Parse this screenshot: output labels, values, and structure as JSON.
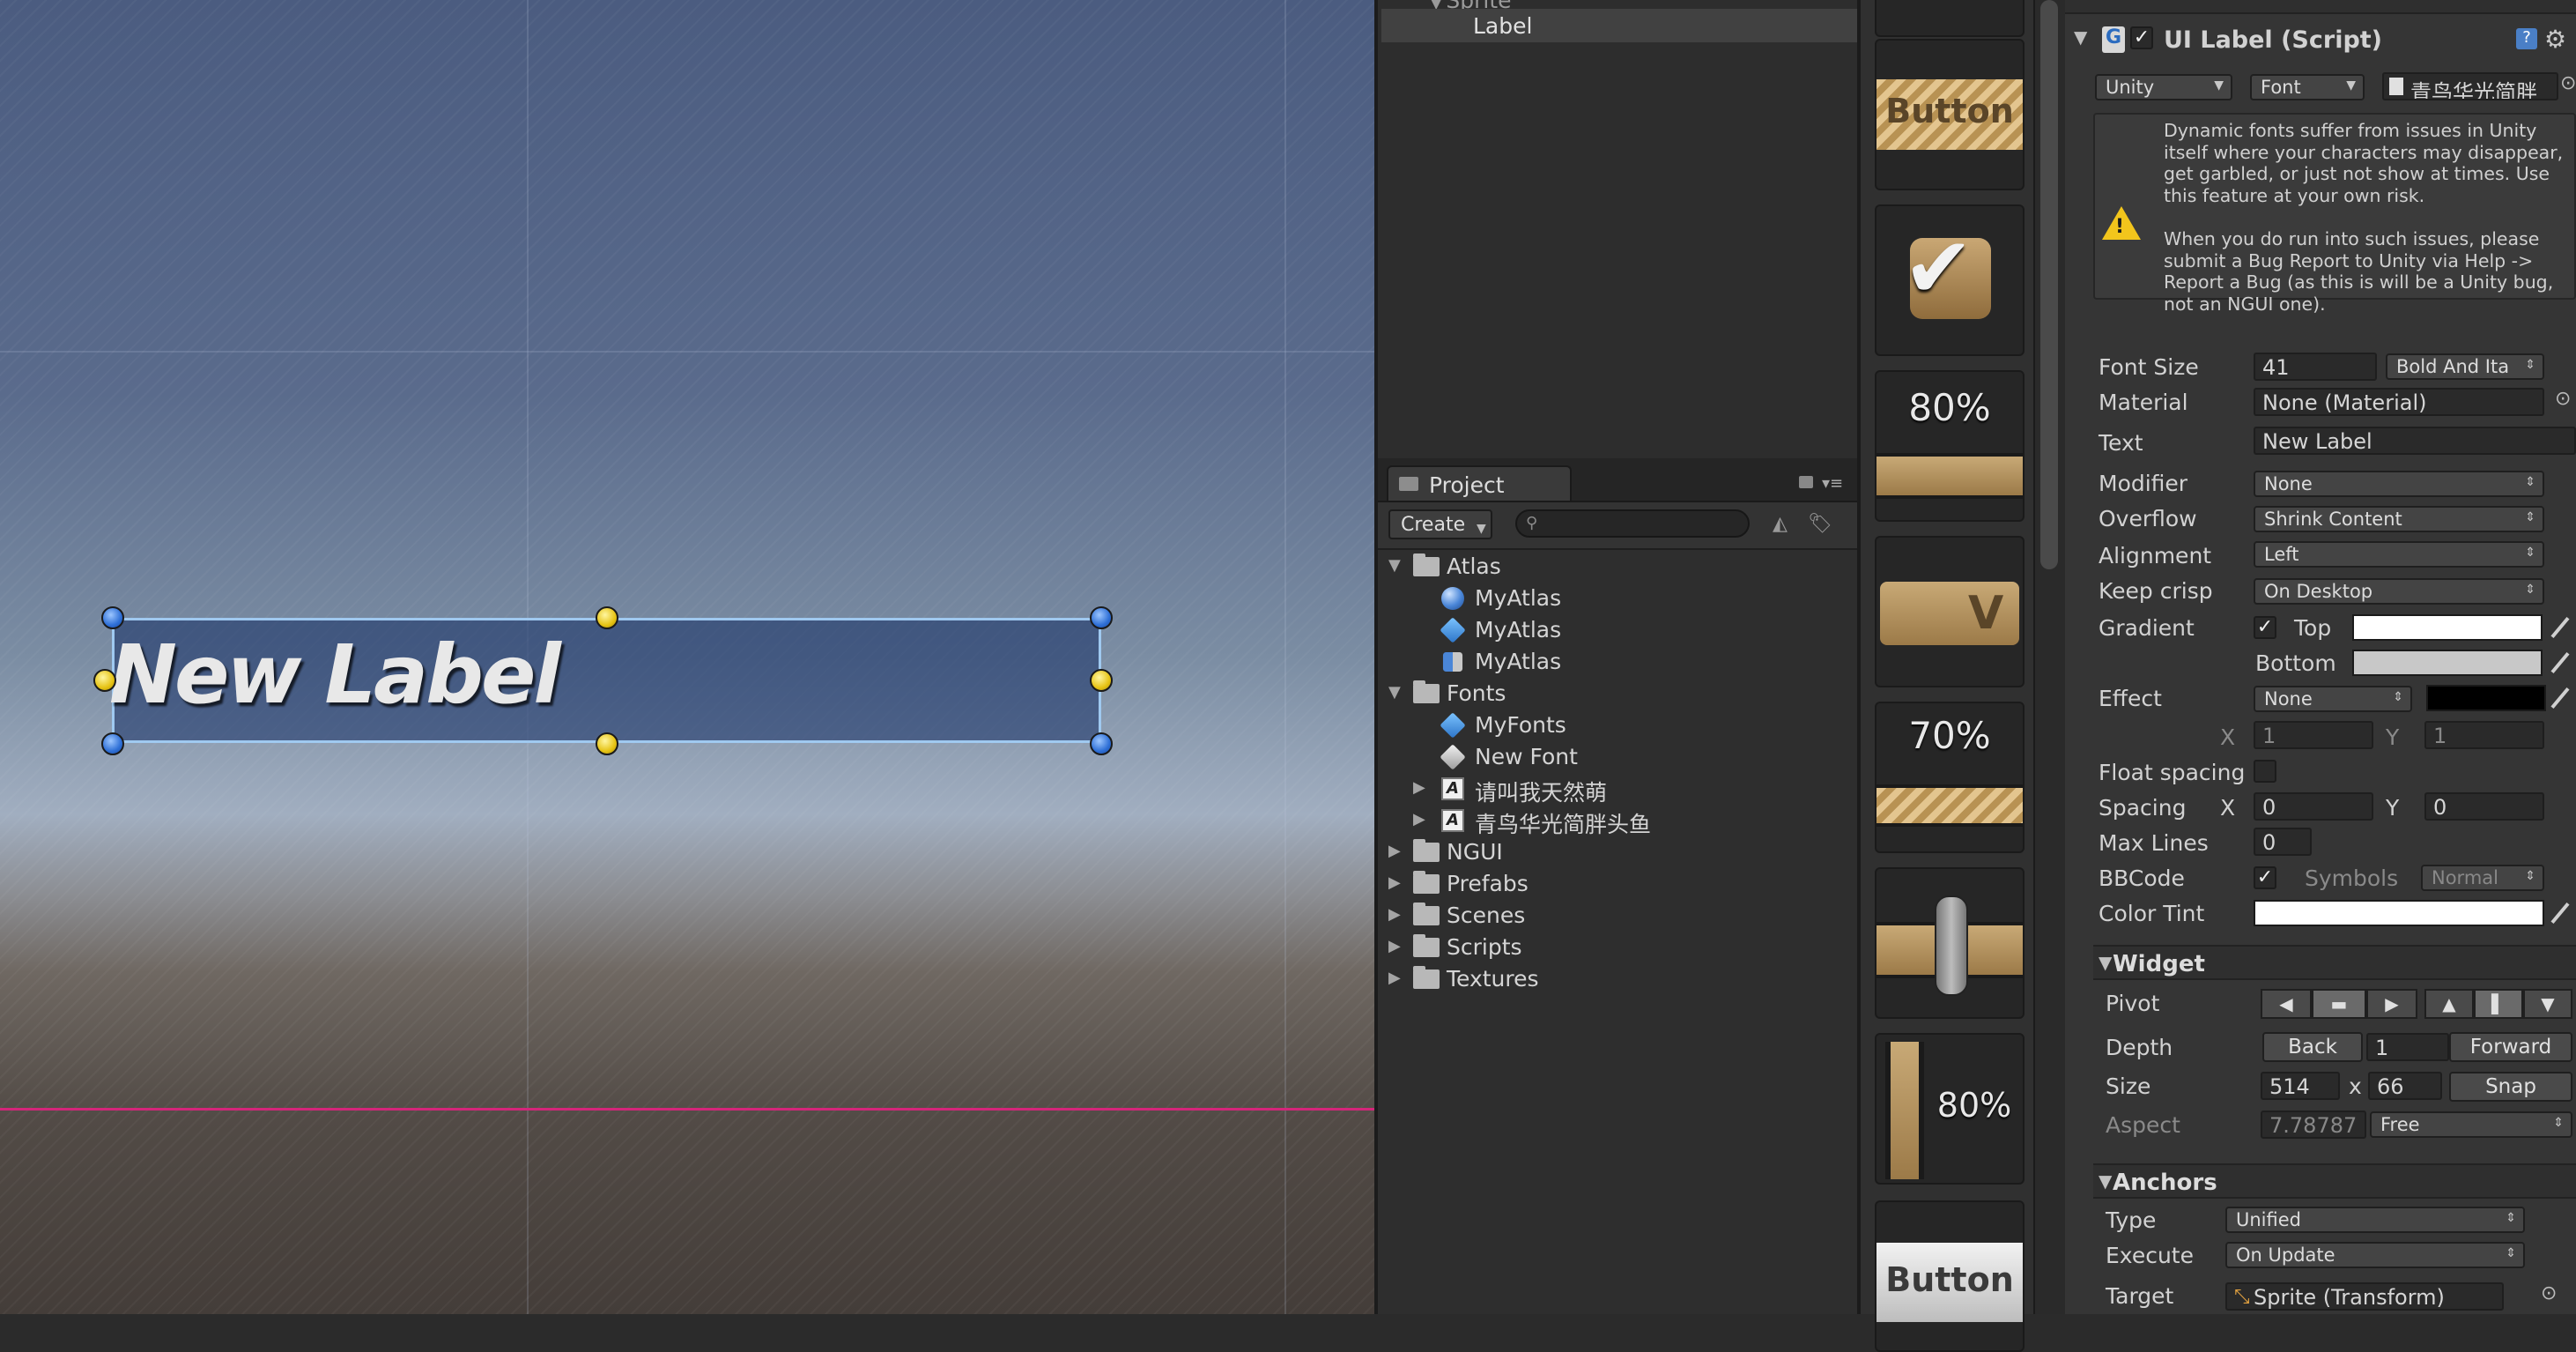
{
  "scene": {
    "label_text": "New Label"
  },
  "hierarchy": {
    "partial_row": "Sprite",
    "selected_row": "Label"
  },
  "project": {
    "tab_label": "Project",
    "create_label": "Create",
    "search_placeholder": "",
    "tree": [
      {
        "label": "Atlas",
        "kind": "folder",
        "expanded": true,
        "indent": 0
      },
      {
        "label": "MyAtlas",
        "kind": "sphere",
        "indent": 1
      },
      {
        "label": "MyAtlas",
        "kind": "cube",
        "indent": 1
      },
      {
        "label": "MyAtlas",
        "kind": "mixed",
        "indent": 1
      },
      {
        "label": "Fonts",
        "kind": "folder",
        "expanded": true,
        "indent": 0
      },
      {
        "label": "MyFonts",
        "kind": "cube",
        "indent": 1
      },
      {
        "label": "New Font",
        "kind": "cube-grey",
        "indent": 1
      },
      {
        "label": "请叫我天然萌",
        "kind": "font",
        "collapsed": true,
        "indent": 1
      },
      {
        "label": "青鸟华光简胖头鱼",
        "kind": "font",
        "collapsed": true,
        "indent": 1
      },
      {
        "label": "NGUI",
        "kind": "folder",
        "expanded": false,
        "indent": 0
      },
      {
        "label": "Prefabs",
        "kind": "folder",
        "expanded": false,
        "indent": 0
      },
      {
        "label": "Scenes",
        "kind": "folder",
        "expanded": false,
        "indent": 0
      },
      {
        "label": "Scripts",
        "kind": "folder",
        "expanded": false,
        "indent": 0
      },
      {
        "label": "Textures",
        "kind": "folder",
        "expanded": false,
        "indent": 0
      }
    ]
  },
  "preview": {
    "button_1": "Button",
    "progress_1": "80%",
    "dropdown_v": "V",
    "progress_2": "70%",
    "vertical_progress": "80%",
    "button_2": "Button"
  },
  "inspector": {
    "component_title": "UI Label (Script)",
    "font_type": "Unity",
    "font_field": "Font",
    "font_asset": "青鸟华光简胖",
    "warning": "Dynamic fonts suffer from issues in Unity itself where your characters may disappear, get garbled, or just not show at times. Use this feature at your own risk.\n\nWhen you do run into such issues, please submit a Bug Report to Unity via Help -> Report a Bug (as this is will be a Unity bug, not an NGUI one).",
    "font_size_label": "Font Size",
    "font_size_value": "41",
    "font_style": "Bold And Ita",
    "material_label": "Material",
    "material_value": "None (Material)",
    "text_label": "Text",
    "text_value": "New Label",
    "modifier_label": "Modifier",
    "modifier_value": "None",
    "overflow_label": "Overflow",
    "overflow_value": "Shrink Content",
    "alignment_label": "Alignment",
    "alignment_value": "Left",
    "keep_crisp_label": "Keep crisp",
    "keep_crisp_value": "On Desktop",
    "gradient_label": "Gradient",
    "gradient_top_label": "Top",
    "gradient_bottom_label": "Bottom",
    "gradient_top_color": "#ffffff",
    "gradient_bottom_color": "#c8c8c8",
    "effect_label": "Effect",
    "effect_value": "None",
    "effect_color": "#000000",
    "effect_x_label": "X",
    "effect_x_value": "1",
    "effect_y_label": "Y",
    "effect_y_value": "1",
    "float_spacing_label": "Float spacing",
    "spacing_label": "Spacing",
    "spacing_x_label": "X",
    "spacing_x_value": "0",
    "spacing_y_label": "Y",
    "spacing_y_value": "0",
    "max_lines_label": "Max Lines",
    "max_lines_value": "0",
    "bbcode_label": "BBCode",
    "symbols_label": "Symbols",
    "symbols_value": "Normal",
    "color_tint_label": "Color Tint",
    "color_tint_color": "#ffffff",
    "widget_header": "Widget",
    "pivot_label": "Pivot",
    "depth_label": "Depth",
    "depth_back": "Back",
    "depth_value": "1",
    "depth_forward": "Forward",
    "size_label": "Size",
    "size_w": "514",
    "size_x": "x",
    "size_h": "66",
    "snap_label": "Snap",
    "aspect_label": "Aspect",
    "aspect_value": "7.78787",
    "aspect_mode": "Free",
    "anchors_header": "Anchors",
    "type_label": "Type",
    "type_value": "Unified",
    "execute_label": "Execute",
    "execute_value": "On Update",
    "target_label": "Target",
    "target_value": "Sprite (Transform)"
  },
  "colors": {
    "selection_outline": "#9fc9f0",
    "guide_line": "#d4257a"
  }
}
